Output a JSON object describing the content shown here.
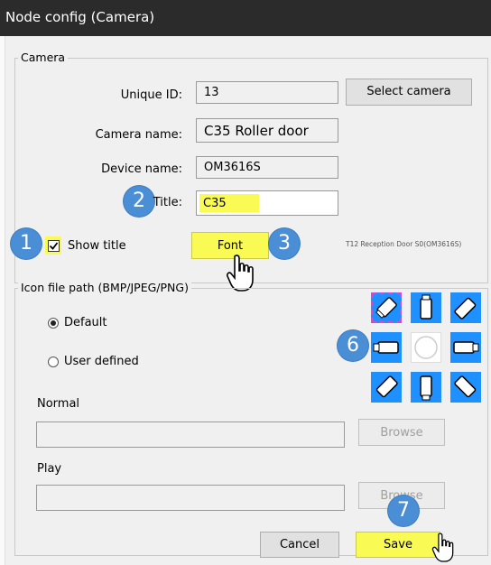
{
  "window": {
    "title": "Node config (Camera)"
  },
  "camera_group": {
    "legend": "Camera",
    "unique_id_label": "Unique ID:",
    "unique_id_value": "13",
    "select_camera_label": "Select camera",
    "camera_name_label": "Camera name:",
    "camera_name_value": "C35 Roller door",
    "device_name_label": "Device name:",
    "device_name_value": "OM3616S",
    "title_label": "Title:",
    "title_value": "C35",
    "show_title_label": "Show title",
    "show_title_checked": true,
    "font_label": "Font",
    "preview_text": "T12 Reception Door S0(OM3616S)"
  },
  "icon_group": {
    "legend": "Icon file path (BMP/JPEG/PNG)",
    "default_label": "Default",
    "user_defined_label": "User defined",
    "selected_option": "Default",
    "normal_label": "Normal",
    "normal_value": "",
    "play_label": "Play",
    "play_value": "",
    "browse_label": "Browse",
    "icons": [
      "camera-diag-up-left-icon",
      "camera-up-icon",
      "camera-diag-up-right-icon",
      "camera-left-icon",
      "camera-center-icon",
      "camera-right-icon",
      "camera-diag-down-left-icon",
      "camera-down-icon",
      "camera-diag-down-right-icon"
    ]
  },
  "footer": {
    "cancel_label": "Cancel",
    "save_label": "Save"
  },
  "annotations": [
    "1",
    "2",
    "3",
    "6",
    "7"
  ],
  "colors": {
    "highlight": "#fafa55",
    "badge": "#4a8ed6",
    "icon_bg": "#1e90ff"
  }
}
